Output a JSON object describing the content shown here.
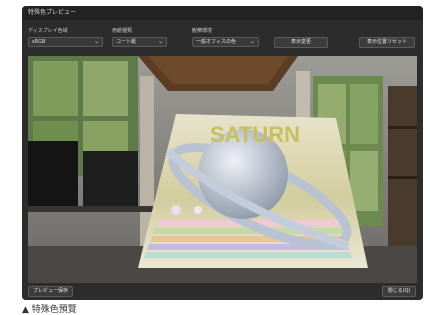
{
  "window": {
    "title": "特殊色プレビュー"
  },
  "controls": {
    "display_label": "ディスプレイ色域",
    "display_value": "sRGB",
    "paper_label": "用紙種類",
    "paper_value": "コート紙",
    "env_label": "観察環境",
    "env_value": "一般オフィスの色",
    "show_change": "表示変更",
    "reset_position": "表示位置リセット"
  },
  "preview": {
    "poster_title": "SATURN"
  },
  "footer": {
    "save": "プレビュー保存",
    "close": "閉じる(Q)"
  },
  "caption": "▲ 特殊色預覽",
  "colors": {
    "window_bg": "#2c2c2c",
    "titlebar_bg": "#232323",
    "poster_title": "#c9c05a"
  }
}
